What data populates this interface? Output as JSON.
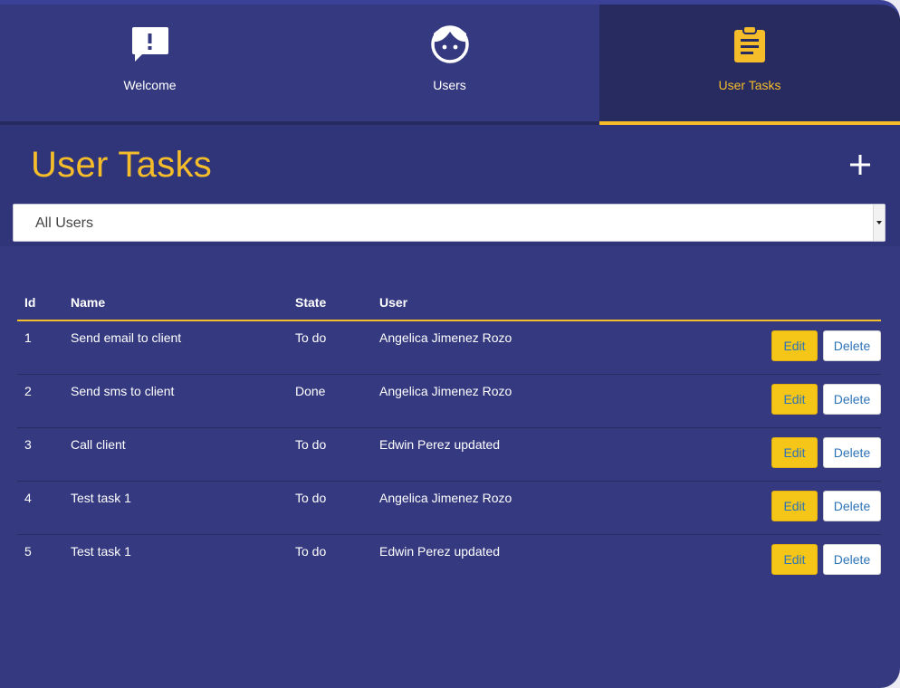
{
  "nav": {
    "tabs": [
      {
        "label": "Welcome",
        "icon": "speech-bubble-exclamation-icon"
      },
      {
        "label": "Users",
        "icon": "face-icon"
      },
      {
        "label": "User Tasks",
        "icon": "clipboard-icon",
        "active": true
      }
    ]
  },
  "page": {
    "title": "User Tasks",
    "add_icon": "plus-icon",
    "filter": {
      "selected": "All Users"
    }
  },
  "table": {
    "headers": {
      "id": "Id",
      "name": "Name",
      "state": "State",
      "user": "User"
    },
    "rows": [
      {
        "id": "1",
        "name": "Send email to client",
        "state": "To do",
        "user": "Angelica Jimenez Rozo",
        "edit": "Edit",
        "delete": "Delete"
      },
      {
        "id": "2",
        "name": "Send sms to client",
        "state": "Done",
        "user": "Angelica Jimenez Rozo",
        "edit": "Edit",
        "delete": "Delete"
      },
      {
        "id": "3",
        "name": "Call client",
        "state": "To do",
        "user": "Edwin Perez updated",
        "edit": "Edit",
        "delete": "Delete"
      },
      {
        "id": "4",
        "name": "Test task 1",
        "state": "To do",
        "user": "Angelica Jimenez Rozo",
        "edit": "Edit",
        "delete": "Delete"
      },
      {
        "id": "5",
        "name": "Test task 1",
        "state": "To do",
        "user": "Edwin Perez updated",
        "edit": "Edit",
        "delete": "Delete"
      }
    ]
  },
  "colors": {
    "background": "#353a80",
    "header_band": "#303579",
    "active_tab": "#272b5f",
    "accent": "#f5bd2a",
    "button_text": "#2d73b8"
  }
}
